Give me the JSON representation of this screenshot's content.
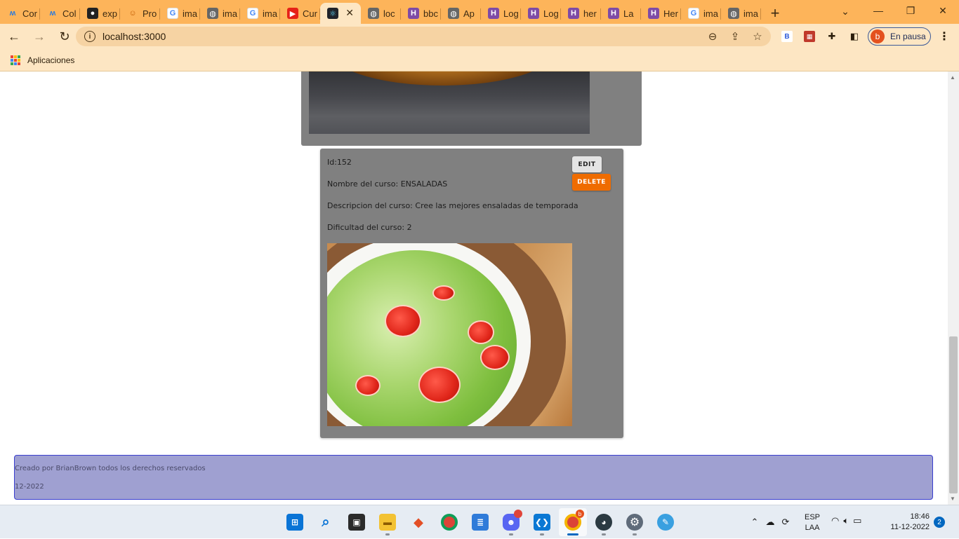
{
  "browser": {
    "tabs": [
      {
        "label": "Cor",
        "icon": "bluetooth-logo-icon"
      },
      {
        "label": "Col",
        "icon": "bluetooth-logo-icon"
      },
      {
        "label": "exp",
        "icon": "github-icon"
      },
      {
        "label": "Pro",
        "icon": "profile-emoji-icon"
      },
      {
        "label": "ima",
        "icon": "google-icon"
      },
      {
        "label": "ima",
        "icon": "globe-icon"
      },
      {
        "label": "ima",
        "icon": "google-icon"
      },
      {
        "label": "Cur",
        "icon": "youtube-icon"
      },
      {
        "label": "",
        "icon": "react-icon",
        "active": true
      },
      {
        "label": "loc",
        "icon": "globe-icon"
      },
      {
        "label": "bbc",
        "icon": "heroku-icon"
      },
      {
        "label": "Ap",
        "icon": "globe-icon"
      },
      {
        "label": "Log",
        "icon": "heroku-icon"
      },
      {
        "label": "Log",
        "icon": "heroku-icon"
      },
      {
        "label": "her",
        "icon": "heroku-icon"
      },
      {
        "label": "La",
        "icon": "heroku-icon"
      },
      {
        "label": "Her",
        "icon": "heroku-icon"
      },
      {
        "label": "ima",
        "icon": "google-icon"
      },
      {
        "label": "ima",
        "icon": "globe-icon"
      }
    ],
    "address": "localhost:3000",
    "profile_label": "En pausa",
    "profile_initial": "b",
    "bookmarks_label": "Aplicaciones"
  },
  "course": {
    "id_text": "Id:152",
    "name_text": "Nombre del curso: ENSALADAS",
    "description_text": "Descripcion del curso: Cree las mejores ensaladas de temporada",
    "difficulty_text": "Dificultad del curso: 2",
    "edit_label": "EDIT",
    "delete_label": "DELETE"
  },
  "footer": {
    "credits": "Creado por BrianBrown todos los derechos reservados",
    "date": "12-2022"
  },
  "taskbar": {
    "language": "ESP",
    "layout": "LAA",
    "time": "18:46",
    "date": "11-12-2022",
    "notification_count": "2",
    "browser_badge": "b"
  },
  "colors": {
    "tab_strip": "#fdb45a",
    "toolbar": "#fde6c3",
    "card": "#808080",
    "delete_button": "#ef6c00",
    "footer_bg": "#9fa0d1",
    "footer_border": "#3a3fcf"
  }
}
